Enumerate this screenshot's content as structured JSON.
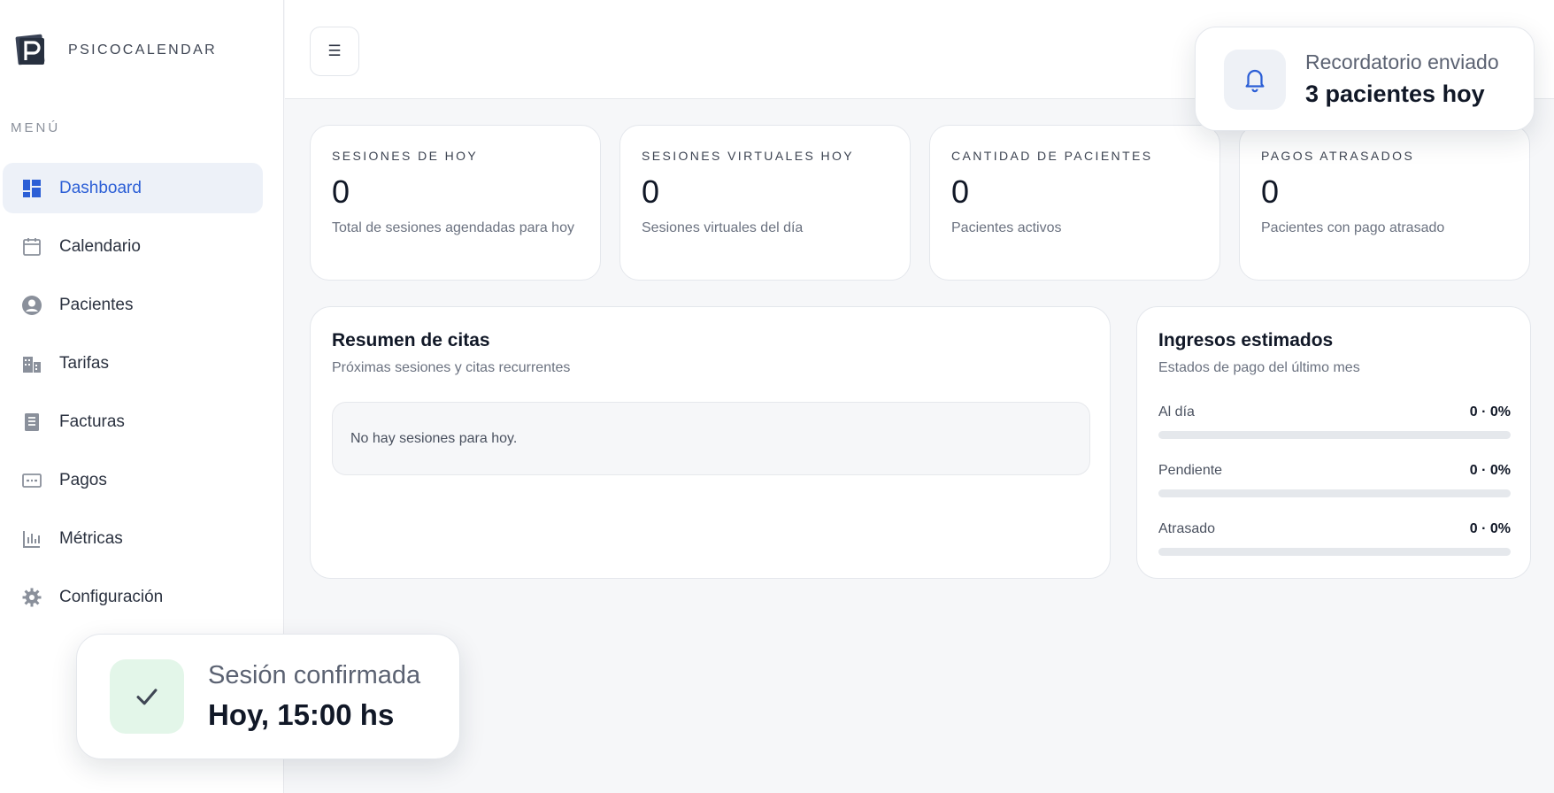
{
  "brand": {
    "name": "PSICOCALENDAR",
    "logo_icon": "p-logo-icon"
  },
  "sidebar": {
    "menu_title": "MENÚ",
    "items": [
      {
        "label": "Dashboard",
        "icon": "dashboard-icon",
        "active": true
      },
      {
        "label": "Calendario",
        "icon": "calendar-icon"
      },
      {
        "label": "Pacientes",
        "icon": "user-circle-icon"
      },
      {
        "label": "Tarifas",
        "icon": "buildings-icon"
      },
      {
        "label": "Facturas",
        "icon": "receipt-icon"
      },
      {
        "label": "Pagos",
        "icon": "card-icon"
      },
      {
        "label": "Métricas",
        "icon": "bar-chart-icon"
      },
      {
        "label": "Configuración",
        "icon": "gear-icon"
      }
    ]
  },
  "header": {
    "menu_button_label": "☰"
  },
  "stats": [
    {
      "title": "SESIONES DE HOY",
      "value": "0",
      "desc": "Total de sesiones agendadas para hoy"
    },
    {
      "title": "SESIONES VIRTUALES HOY",
      "value": "0",
      "desc": "Sesiones virtuales del día"
    },
    {
      "title": "CANTIDAD DE PACIENTES",
      "value": "0",
      "desc": "Pacientes activos"
    },
    {
      "title": "PAGOS ATRASADOS",
      "value": "0",
      "desc": "Pacientes con pago atrasado"
    }
  ],
  "summary": {
    "title": "Resumen de citas",
    "subtitle": "Próximas sesiones y citas recurrentes",
    "empty_text": "No hay sesiones para hoy."
  },
  "income": {
    "title": "Ingresos estimados",
    "subtitle": "Estados de pago del último mes",
    "rows": [
      {
        "label": "Al día",
        "value": "0 · 0%",
        "fraction": 0
      },
      {
        "label": "Pendiente",
        "value": "0 · 0%",
        "fraction": 0
      },
      {
        "label": "Atrasado",
        "value": "0 · 0%",
        "fraction": 0
      }
    ]
  },
  "toasts": {
    "reminder": {
      "line1": "Recordatorio enviado",
      "line2": "3 pacientes hoy",
      "icon": "bell-icon"
    },
    "confirmed": {
      "line1": "Sesión confirmada",
      "line2": "Hoy, 15:00 hs",
      "icon": "check-icon"
    }
  },
  "colors": {
    "accent": "#2c5fd6",
    "active_bg": "#edf1f8",
    "success_bg": "#e3f6e9"
  }
}
